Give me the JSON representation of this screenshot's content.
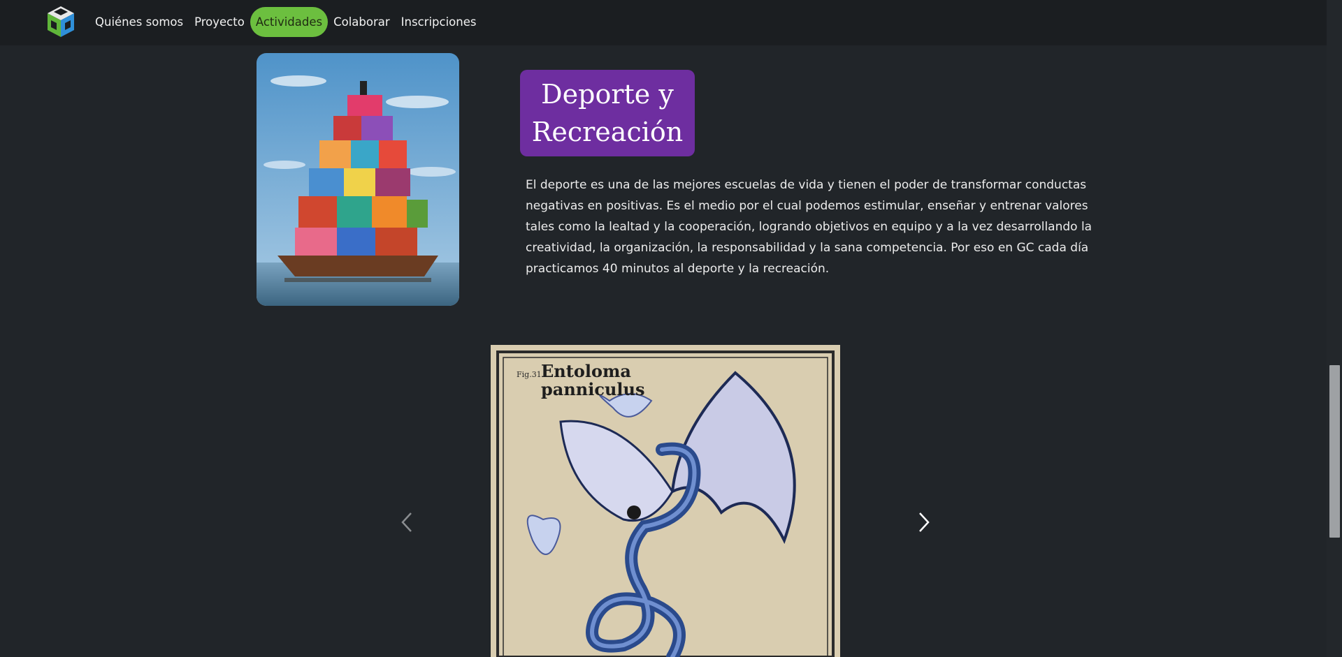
{
  "nav": {
    "logo_icon": "cube-logo-icon",
    "items": [
      {
        "label": "Quiénes somos",
        "active": false
      },
      {
        "label": "Proyecto",
        "active": false
      },
      {
        "label": "Actividades",
        "active": true
      },
      {
        "label": "Colaborar",
        "active": false
      },
      {
        "label": "Inscripciones",
        "active": false
      }
    ]
  },
  "section": {
    "title": "Deporte y Recreación",
    "description": "El deporte es una de las mejores escuelas de vida y tienen el poder de transformar conductas negativas en positivas. Es el medio por el cual podemos estimular, enseñar y entrenar valores tales como la lealtad y la cooperación, logrando objetivos en equipo y a la vez desarrollando la creatividad, la organización, la responsabilidad y la sana competencia. Por eso en GC cada día practicamos 40 minutos al deporte y la recreación.",
    "image_icon": "houses-on-boat-image"
  },
  "carousel": {
    "slide_fig": "Fig.31",
    "slide_title_line1": "Entoloma",
    "slide_title_line2": "panniculus",
    "prev_icon": "chevron-left-icon",
    "next_icon": "chevron-right-icon"
  },
  "colors": {
    "background": "#212529",
    "navbar": "#1b1e21",
    "active_pill": "#6cbf3f",
    "title_badge": "#6e2ea0"
  }
}
